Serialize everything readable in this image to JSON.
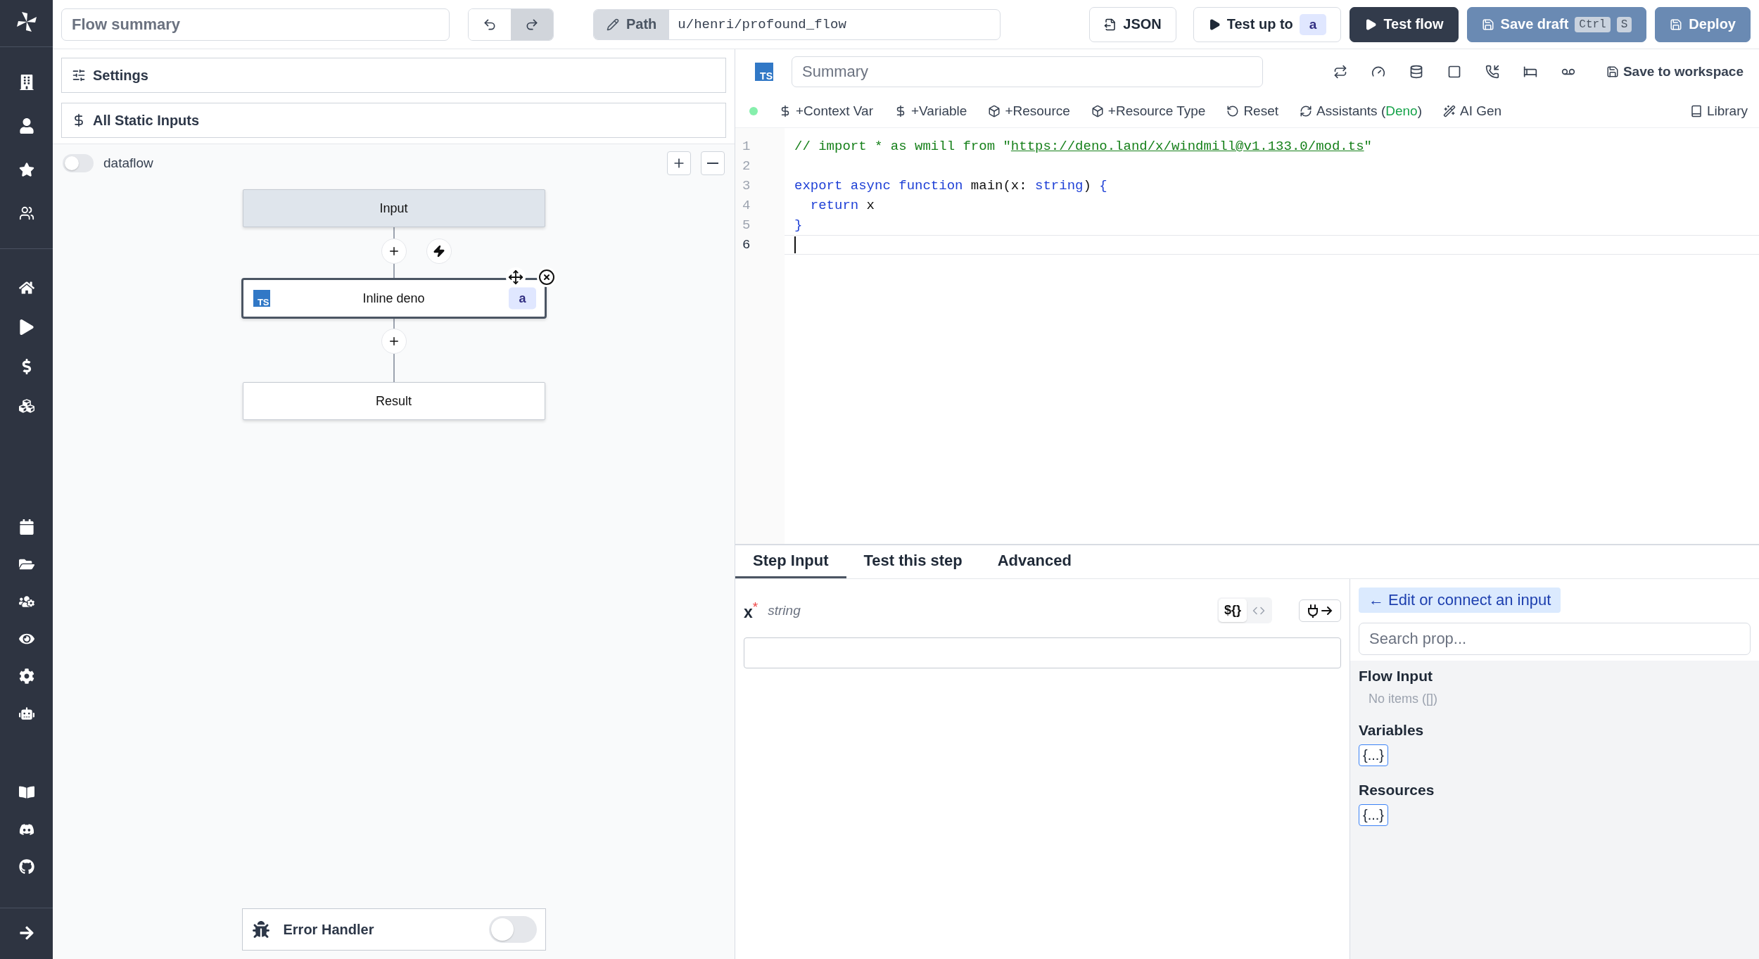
{
  "header": {
    "summary_placeholder": "Flow summary",
    "path_label": "Path",
    "path": "u/henri/profound_flow",
    "buttons": [
      {
        "kind": "json",
        "label": "JSON"
      },
      {
        "kind": "test-up-to",
        "label": "Test up to",
        "badge": "a"
      },
      {
        "kind": "test-flow",
        "label": "Test flow"
      },
      {
        "kind": "save-draft",
        "label": "Save draft",
        "keys": [
          "Ctrl",
          "S"
        ]
      },
      {
        "kind": "deploy",
        "label": "Deploy"
      }
    ]
  },
  "flow_panel": {
    "sections": [
      {
        "kind": "settings",
        "label": "Settings"
      },
      {
        "kind": "static-inputs",
        "label": "All Static Inputs"
      }
    ],
    "dataflow": {
      "label": "dataflow",
      "on": false
    },
    "nodes": [
      {
        "kind": "input",
        "label": "Input",
        "selected": false
      },
      {
        "kind": "script",
        "label": "Inline deno",
        "lang_badge": "TS",
        "badge": "a",
        "selected": true
      },
      {
        "kind": "result",
        "label": "Result",
        "selected": false
      }
    ],
    "error_handler": {
      "label": "Error Handler",
      "on": false
    }
  },
  "editor": {
    "lang_badge": "TS",
    "summary_placeholder": "Summary",
    "save_label": "Save to workspace",
    "toolbar": [
      {
        "kind": "dollar",
        "parts": [
          {
            "text": "+Context Var",
            "accent": false
          }
        ]
      },
      {
        "kind": "dollar",
        "parts": [
          {
            "text": "+Variable",
            "accent": false
          }
        ]
      },
      {
        "kind": "cube",
        "parts": [
          {
            "text": "+Resource",
            "accent": false
          }
        ]
      },
      {
        "kind": "cube",
        "parts": [
          {
            "text": "+Resource Type",
            "accent": false
          }
        ]
      },
      {
        "kind": "reset",
        "parts": [
          {
            "text": "Reset",
            "accent": false
          }
        ]
      },
      {
        "kind": "refresh",
        "parts": [
          {
            "text": "Assistants (",
            "accent": false
          },
          {
            "text": "Deno",
            "accent": true
          },
          {
            "text": ")",
            "accent": false
          }
        ]
      },
      {
        "kind": "wand",
        "parts": [
          {
            "text": "AI Gen",
            "accent": false
          }
        ]
      }
    ],
    "library": "Library",
    "lines": [
      {
        "number": "1",
        "current": false,
        "tokens": [
          {
            "kind": "comment",
            "t": "// import * as wmill from \""
          },
          {
            "kind": "link",
            "t": "https://deno.land/x/windmill@v1.133.0/mod.ts"
          },
          {
            "kind": "comment",
            "t": "\""
          }
        ]
      },
      {
        "number": "2",
        "current": false
      },
      {
        "number": "3",
        "current": false,
        "tokens": [
          {
            "kind": "keyword",
            "t": "export async function "
          },
          {
            "kind": "plain",
            "t": "main(x: "
          },
          {
            "kind": "keyword",
            "t": "string"
          },
          {
            "kind": "plain",
            "t": ") "
          },
          {
            "kind": "keyword",
            "t": "{"
          }
        ]
      },
      {
        "number": "4",
        "current": false,
        "tokens": [
          {
            "kind": "keyword",
            "t": "  return"
          },
          {
            "kind": "plain",
            "t": " x"
          }
        ]
      },
      {
        "number": "5",
        "current": false,
        "tokens": [
          {
            "kind": "keyword",
            "t": "}"
          }
        ]
      },
      {
        "number": "6",
        "current": true
      }
    ]
  },
  "step_panel": {
    "tabs": [
      {
        "label": "Step Input",
        "selected": true
      },
      {
        "label": "Test this step",
        "selected": false
      },
      {
        "label": "Advanced",
        "selected": false
      }
    ],
    "arg": {
      "name": "x",
      "required": "*",
      "type": "string",
      "mode_label": "${}"
    },
    "side": {
      "connect": "← Edit or connect an input",
      "search_placeholder": "Search prop...",
      "groups": [
        {
          "title": "Flow Input",
          "empty": "No items ([])"
        },
        {
          "title": "Variables",
          "value": "{...}"
        },
        {
          "title": "Resources",
          "value": "{...}"
        }
      ]
    }
  }
}
